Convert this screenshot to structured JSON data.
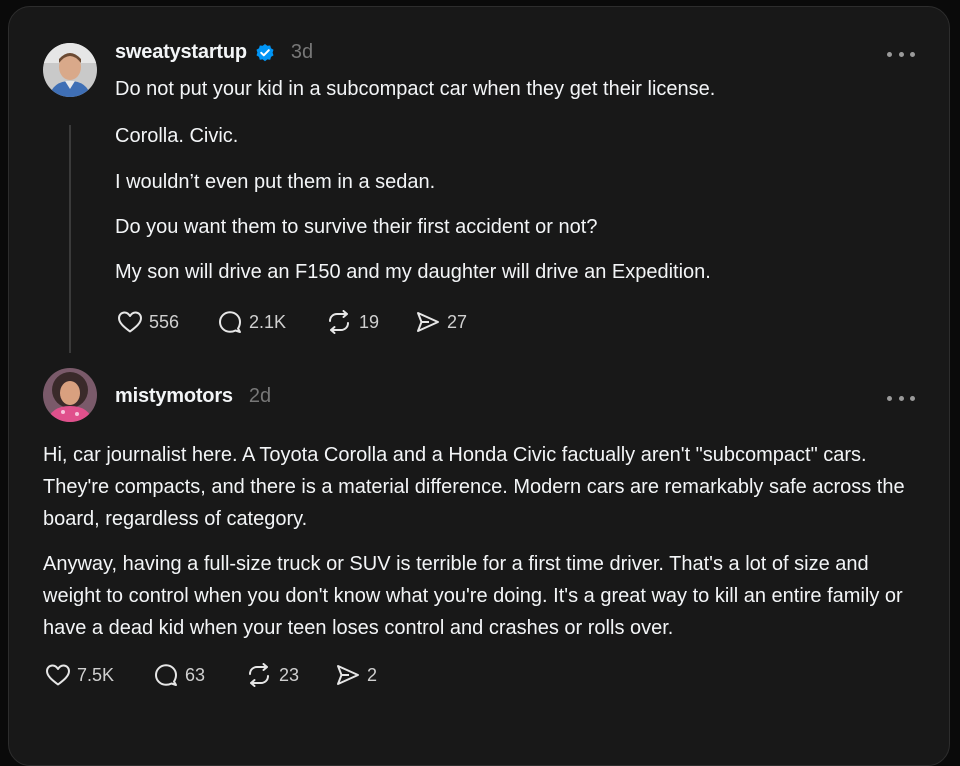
{
  "posts": [
    {
      "username": "sweatystartup",
      "verified": true,
      "time": "3d",
      "paragraphs": [
        "Do not put your kid in a subcompact car when they get their license.",
        "Corolla. Civic.",
        "I wouldn’t even put them in a sedan.",
        "Do you want them to survive their first accident or not?",
        "My son will drive an F150 and my daughter will drive an Expedition."
      ],
      "stats": {
        "likes": "556",
        "replies": "2.1K",
        "reposts": "19",
        "shares": "27"
      }
    },
    {
      "username": "mistymotors",
      "verified": false,
      "time": "2d",
      "paragraphs": [
        "Hi, car journalist here. A Toyota Corolla and a Honda Civic factually aren't \"subcompact\" cars. They're compacts, and there is a material difference. Modern cars are remarkably safe across the board, regardless of category.",
        "Anyway, having a full-size truck or SUV is terrible for a first time driver. That's a lot of size and weight to control when you don't know what you're doing. It's a great way to kill an entire family or have a dead kid when your teen loses control and crashes or rolls over."
      ],
      "stats": {
        "likes": "7.5K",
        "replies": "63",
        "reposts": "23",
        "shares": "2"
      }
    }
  ],
  "icons": {
    "verified": "verified-badge-icon",
    "more": "more-horizontal-icon",
    "like": "heart-icon",
    "reply": "comment-bubble-icon",
    "repost": "repost-icon",
    "share": "send-icon"
  },
  "colors": {
    "background": "#181818",
    "text": "#f3f5f7",
    "muted": "#777777",
    "verified": "#0095f6"
  }
}
